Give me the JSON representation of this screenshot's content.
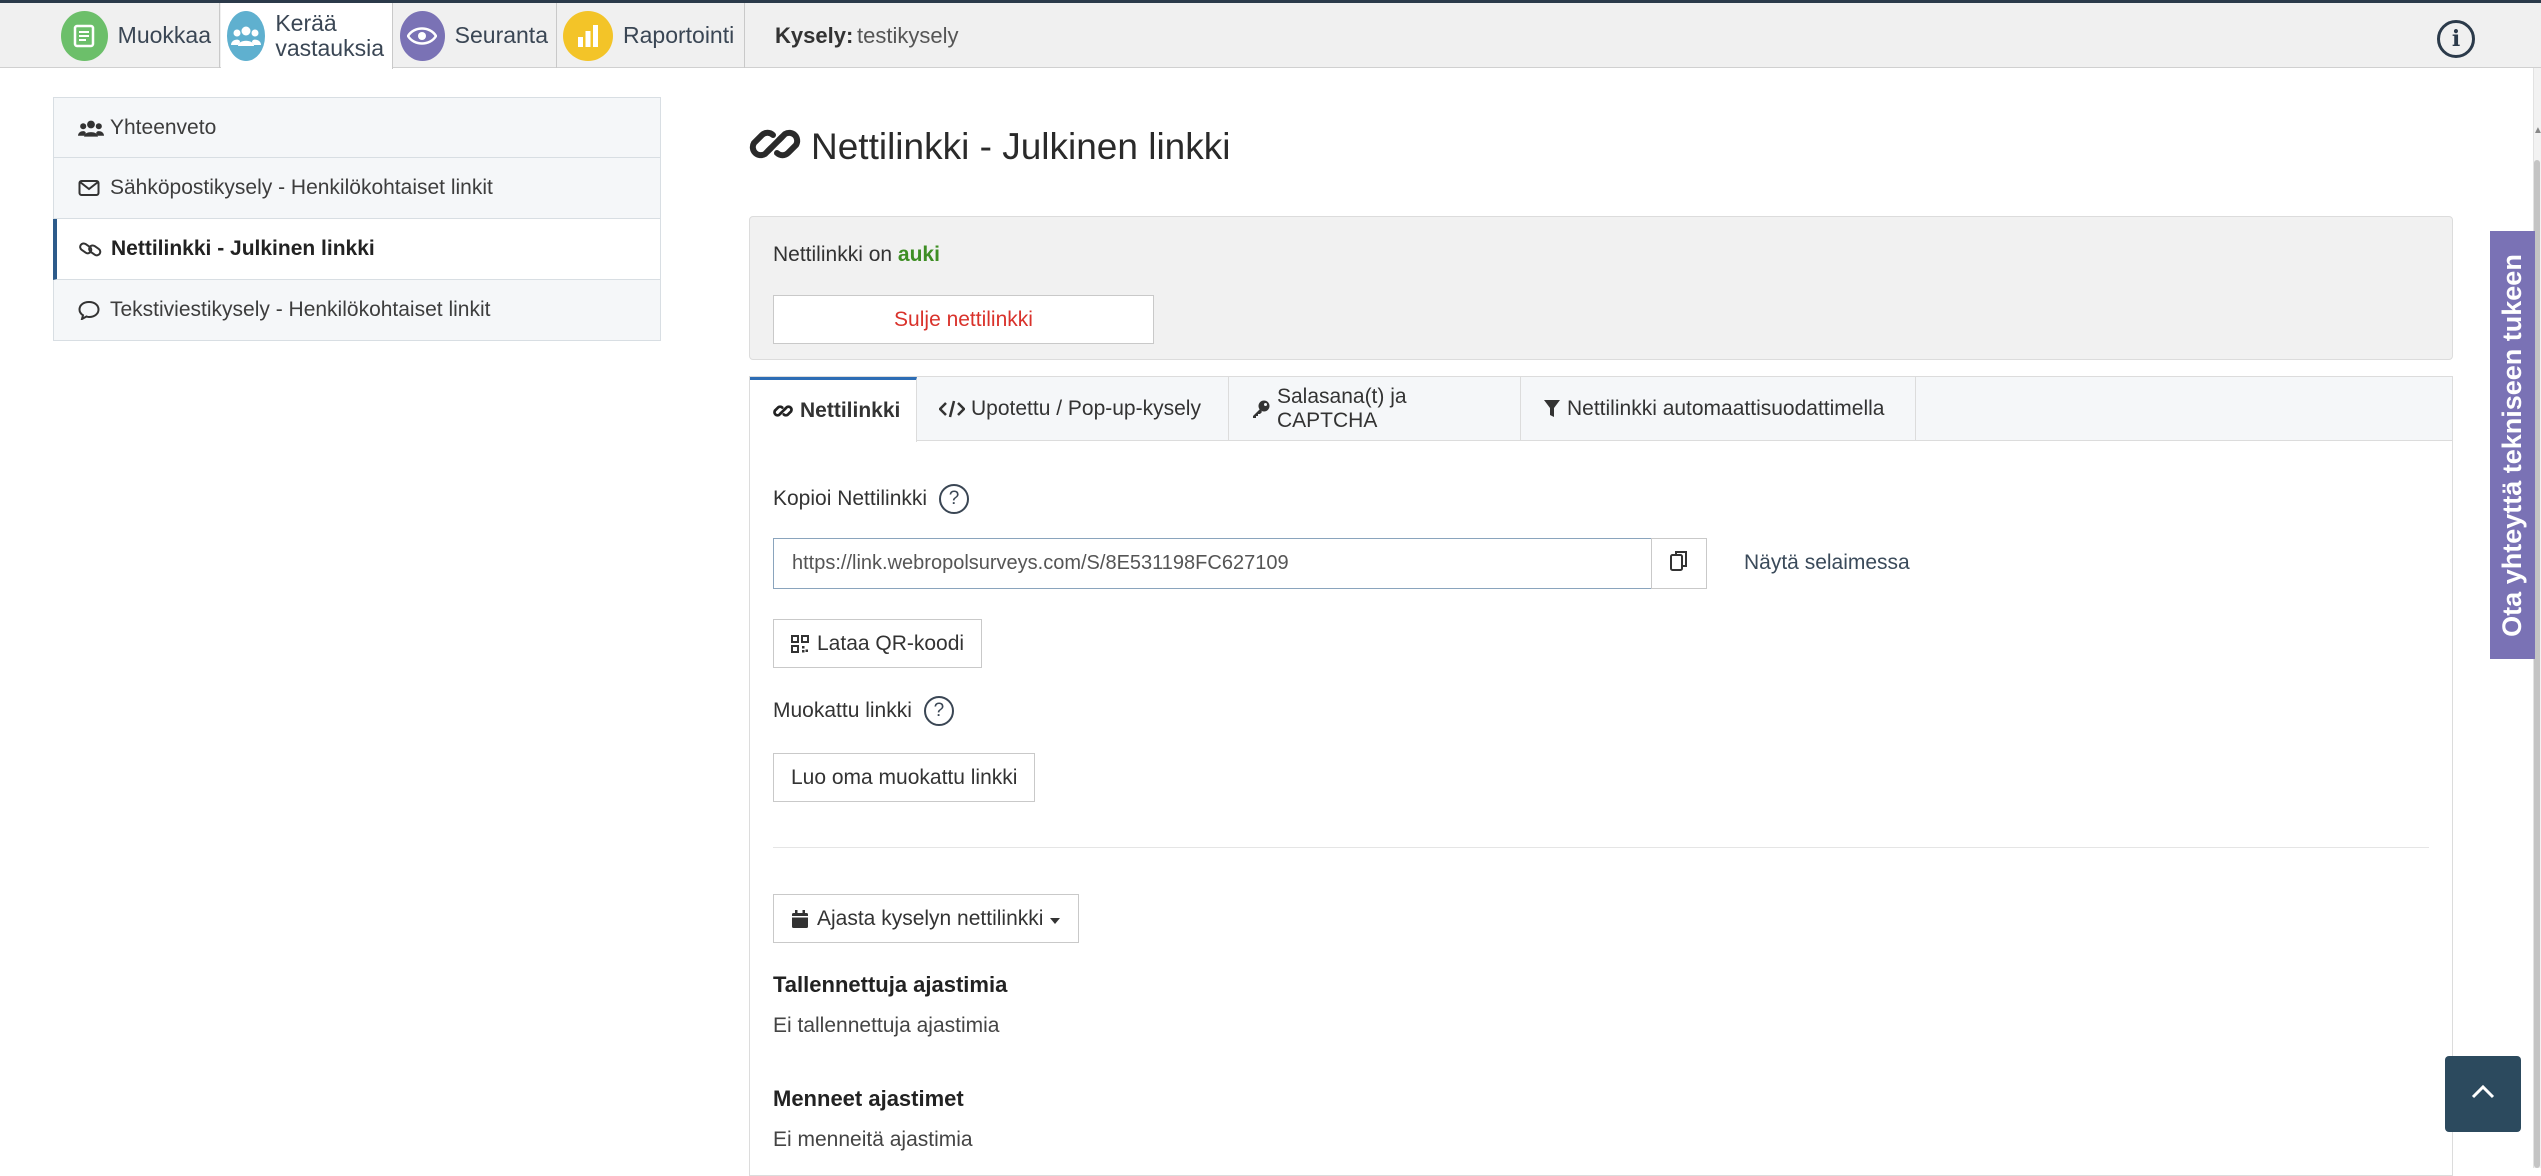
{
  "topnav": {
    "tabs": [
      {
        "label": "Muokkaa",
        "icon": "edit-document-icon",
        "color": "#6cbf6a"
      },
      {
        "label_line1": "Kerää",
        "label_line2": "vastauksia",
        "icon": "users-icon",
        "color": "#5fb0cf"
      },
      {
        "label": "Seuranta",
        "icon": "eye-icon",
        "color": "#7a72b5"
      },
      {
        "label": "Raportointi",
        "icon": "bar-chart-icon",
        "color": "#f3c428"
      }
    ],
    "survey_label": "Kysely:",
    "survey_name": "testikysely"
  },
  "sidebar": {
    "items": [
      {
        "label": "Yhteenveto",
        "icon": "users-icon"
      },
      {
        "label": "Sähköpostikysely - Henkilökohtaiset linkit",
        "icon": "envelope-icon"
      },
      {
        "label": "Nettilinkki - Julkinen linkki",
        "icon": "link-icon",
        "active": true
      },
      {
        "label": "Tekstiviestikysely - Henkilökohtaiset linkit",
        "icon": "comment-icon"
      }
    ]
  },
  "main": {
    "title": "Nettilinkki - Julkinen linkki",
    "status_prefix": "Nettilinkki on",
    "status_value": "auki",
    "close_button": "Sulje nettilinkki",
    "tabs": [
      {
        "label": "Nettilinkki",
        "icon": "link-icon"
      },
      {
        "label": "Upotettu / Pop-up-kysely",
        "icon": "code-icon"
      },
      {
        "label": "Salasana(t) ja CAPTCHA",
        "icon": "key-icon"
      },
      {
        "label": "Nettilinkki automaattisuodattimella",
        "icon": "filter-icon"
      }
    ],
    "copy_label": "Kopioi Nettilinkki",
    "help_glyph": "?",
    "url_value": "https://link.webropolsurveys.com/S/8E531198FC627109",
    "open_in_browser": "Näytä selaimessa",
    "qr_button": "Lataa QR-koodi",
    "custom_link_label": "Muokattu linkki",
    "custom_link_button": "Luo oma muokattu linkki",
    "schedule_button": "Ajasta kyselyn nettilinkki",
    "saved_timers_heading": "Tallennettuja ajastimia",
    "saved_timers_text": "Ei tallennettuja ajastimia",
    "past_timers_heading": "Menneet ajastimet",
    "past_timers_text": "Ei menneitä ajastimia"
  },
  "support_tab": "Ota yhteyttä tekniseen tukeen",
  "colors": {
    "open_status": "#3e8e24",
    "close_button_text": "#d9322b",
    "support_tab_bg": "#7a72b5",
    "back_to_top_bg": "#2c4a5e"
  }
}
